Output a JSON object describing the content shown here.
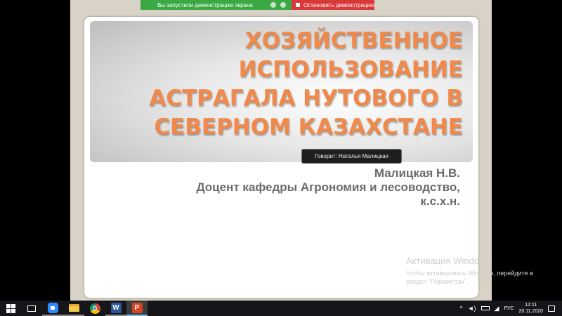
{
  "share_bar": {
    "status": "Вы запустили демонстрацию экрана",
    "stop_label": "Остановить демонстрацию",
    "green": "#3aa843",
    "red": "#d9383a"
  },
  "slide": {
    "title_lines": [
      "ХОЗЯЙСТВЕННОЕ",
      "ИСПОЛЬЗОВАНИЕ",
      "АСТРАГАЛА НУТОВОГО В",
      "СЕВЕРНОМ КАЗАХСТАНЕ"
    ],
    "title_color": "#f0894a",
    "author_lines": [
      "Малицкая Н.В.",
      "Доцент кафедры Агрономия и лесоводство,",
      "к.с.х.н."
    ],
    "author_color": "#6b6b6b"
  },
  "speaker": {
    "label": "Говорит: Наталья Малицкая"
  },
  "activation": {
    "title": "Активация Windows",
    "line1": "Чтобы активировать Windows, перейдите в",
    "line2": "раздел \"Параметры\"."
  },
  "taskbar": {
    "apps": [
      "windows-start",
      "task-view",
      "zoom",
      "file-explorer",
      "chrome",
      "word",
      "powerpoint"
    ],
    "lang": "РУС",
    "time": "12:11",
    "date": "20.11.2020"
  }
}
